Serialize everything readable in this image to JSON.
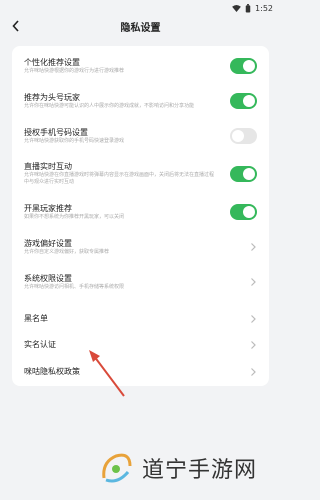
{
  "status_bar": {
    "time": "1:52",
    "wifi_icon": "wifi-icon",
    "battery_icon": "battery-icon"
  },
  "header": {
    "title": "隐私设置",
    "back_icon": "back-arrow-icon"
  },
  "colors": {
    "accent": "#35b85b",
    "toggle_off": "#e6e6e6",
    "annotation": "#d94a3a"
  },
  "settings": [
    {
      "title": "个性化推荐设置",
      "desc": "允许咪咕快游根据你的游戏行为进行游戏推荐",
      "control": "toggle",
      "on": true
    },
    {
      "title": "推荐为头号玩家",
      "desc": "允许你在咪咕快游可能认识的人中展示你的游戏成就，不影响访问和分享功能",
      "control": "toggle",
      "on": true
    },
    {
      "title": "授权手机号码设置",
      "desc": "允许咪咕快游获取你的手机号码快速登录游戏",
      "control": "toggle",
      "on": false
    },
    {
      "title": "直播实时互动",
      "desc": "允许咪咕快游在你直播游戏时将弹幕内容显示在游戏画面中，关闭后将无法在直播过程中与观众进行实时互动",
      "control": "toggle",
      "on": true
    },
    {
      "title": "开黑玩家推荐",
      "desc": "如果你不想系统为你推荐开黑玩家，可以关闭",
      "control": "toggle",
      "on": true
    },
    {
      "title": "游戏偏好设置",
      "desc": "允许你自定义游戏偏好，获取专属推荐",
      "control": "chevron"
    },
    {
      "title": "系统权限设置",
      "desc": "允许咪咕快游访问相机、手机存储等系统权限",
      "control": "chevron"
    },
    {
      "title": "黑名单",
      "desc": "",
      "control": "chevron"
    },
    {
      "title": "实名认证",
      "desc": "",
      "control": "chevron"
    },
    {
      "title": "咪咕隐私权政策",
      "desc": "",
      "control": "chevron"
    }
  ],
  "watermark": {
    "text": "道宁手游网",
    "logo_icon": "watermark-logo-icon"
  }
}
